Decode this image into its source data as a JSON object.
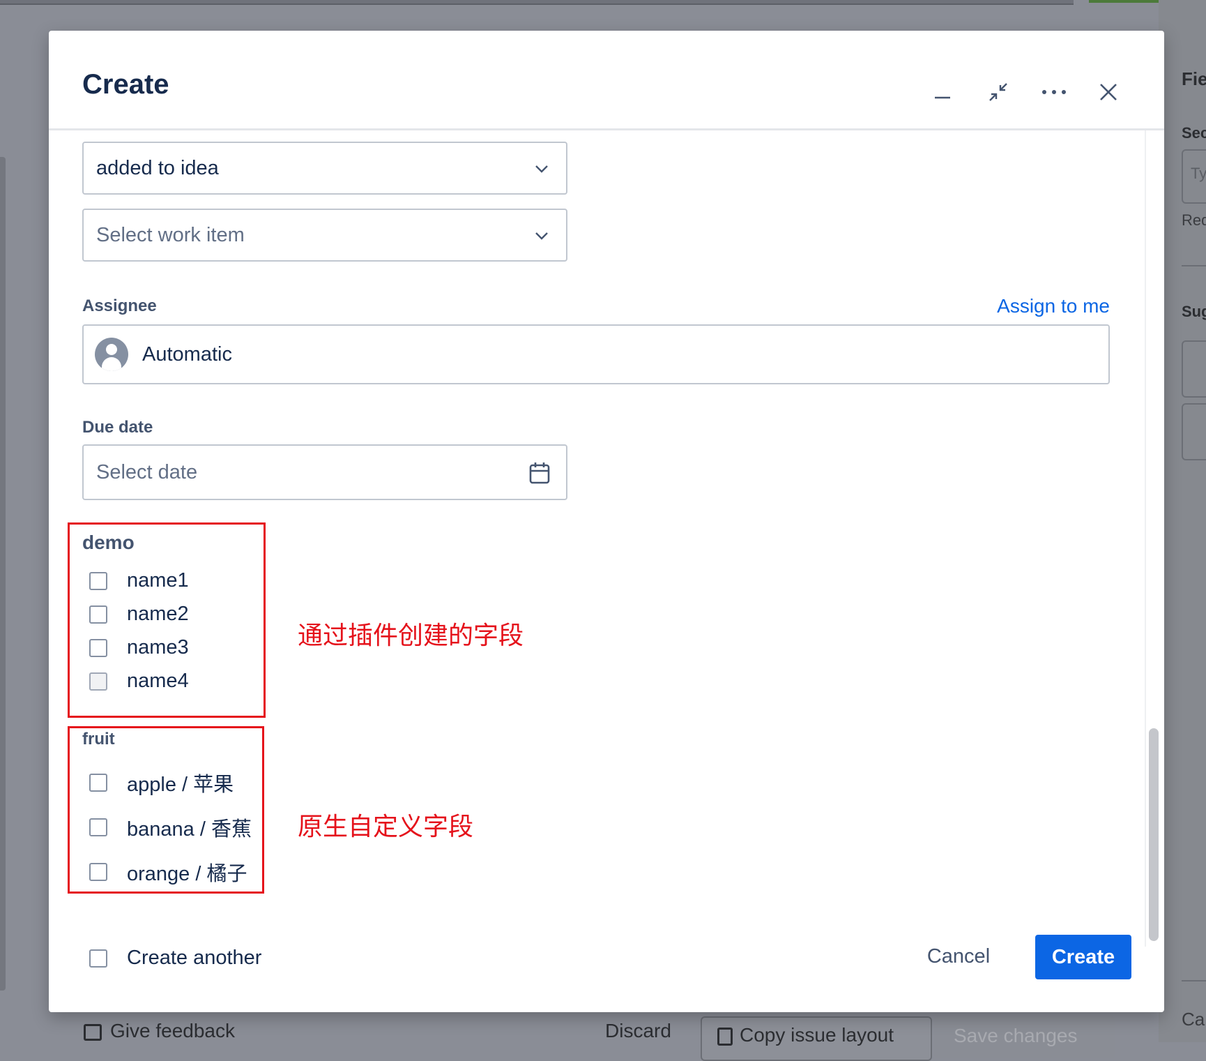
{
  "background": {
    "right_panel": {
      "title": "Fie",
      "sec": "Sec",
      "input_placeholder": "Ty",
      "req": "Req",
      "sug": "Sug",
      "ca": "Ca"
    },
    "footer": {
      "feedback": "Give feedback",
      "discard": "Discard",
      "copy_layout": "Copy issue layout",
      "save": "Save changes"
    }
  },
  "modal": {
    "title": "Create",
    "header_icons": [
      "minimize-icon",
      "collapse-icon",
      "more-icon",
      "close-icon"
    ],
    "fields": {
      "status_select": {
        "value": "added to idea"
      },
      "work_item_select": {
        "placeholder": "Select work item"
      },
      "assignee": {
        "label": "Assignee",
        "assign_link": "Assign to me",
        "value": "Automatic"
      },
      "due_date": {
        "label": "Due date",
        "placeholder": "Select date"
      }
    },
    "demo_group": {
      "label": "demo",
      "options": [
        "name1",
        "name2",
        "name3",
        "name4"
      ],
      "annotation": "通过插件创建的字段"
    },
    "fruit_group": {
      "label": "fruit",
      "options": [
        "apple / 苹果",
        "banana / 香蕉",
        "orange / 橘子"
      ],
      "annotation": "原生自定义字段"
    },
    "footer": {
      "create_another": "Create another",
      "cancel": "Cancel",
      "create": "Create"
    }
  },
  "colors": {
    "primary": "#0c66e4",
    "annotation": "#e5121b",
    "overlay": "#8a8d96"
  }
}
